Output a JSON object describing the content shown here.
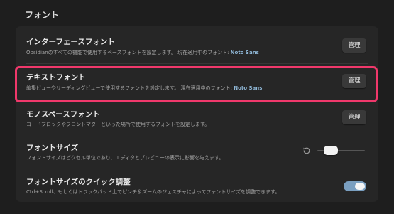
{
  "section": {
    "title": "フォント"
  },
  "settings": [
    {
      "name": "インターフェースフォント",
      "description": "Obsidianのすべての機能で使用するベースフォントを設定します。",
      "current_label": "現在適用中のフォント:",
      "current_value": "Noto Sans",
      "button_label": "管理"
    },
    {
      "name": "テキストフォント",
      "description": "編集ビューやリーディングビューで使用するフォントを設定します。",
      "current_label": "現在適用中のフォント:",
      "current_value": "Noto Sans",
      "button_label": "管理"
    },
    {
      "name": "モノスペースフォント",
      "description": "コードブロックやフロントマターといった場所で使用するフォントを設定します。",
      "button_label": "管理"
    },
    {
      "name": "フォントサイズ",
      "description": "フォントサイズはピクセル単位であり、エディタとプレビューの表示に影響を与えます。",
      "slider_level": 0.25
    },
    {
      "name": "フォントサイズのクイック調整",
      "description": "Ctrl+Scroll、もしくはトラックパッド上でピンチ＆ズームのジェスチャによってフォントサイズを調整できます。",
      "toggle_on": true
    }
  ],
  "colors": {
    "highlight": "#f0386b",
    "accent": "#7a9fc0",
    "font_value": "#8fb7d6"
  },
  "icons": {
    "reset": "reset-icon"
  }
}
